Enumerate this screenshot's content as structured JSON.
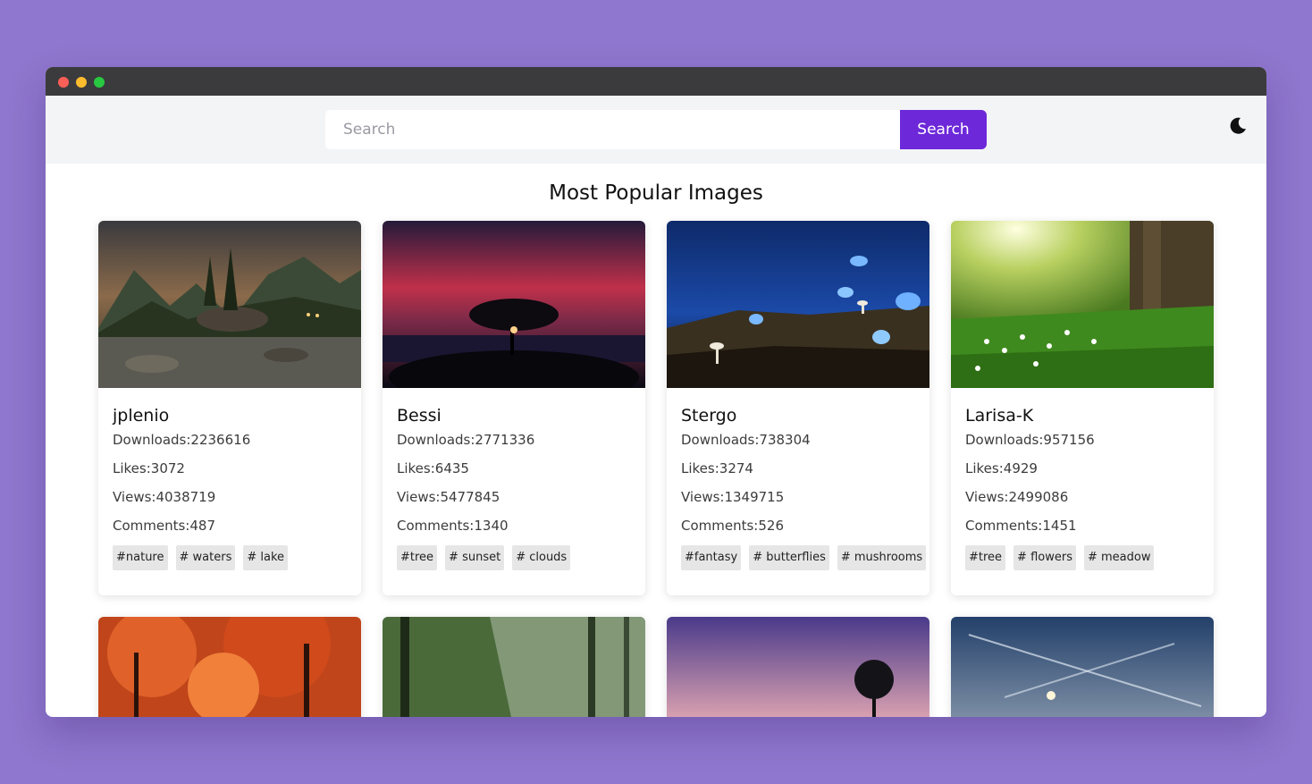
{
  "search": {
    "placeholder": "Search",
    "button_label": "Search"
  },
  "page": {
    "title": "Most Popular Images"
  },
  "cards": [
    {
      "user": "jplenio",
      "downloads": "Downloads:2236616",
      "likes": "Likes:3072",
      "views": "Views:4038719",
      "comments": "Comments:487",
      "tags": [
        "#nature",
        "# waters",
        "# lake"
      ]
    },
    {
      "user": "Bessi",
      "downloads": "Downloads:2771336",
      "likes": "Likes:6435",
      "views": "Views:5477845",
      "comments": "Comments:1340",
      "tags": [
        "#tree",
        "# sunset",
        "# clouds"
      ]
    },
    {
      "user": "Stergo",
      "downloads": "Downloads:738304",
      "likes": "Likes:3274",
      "views": "Views:1349715",
      "comments": "Comments:526",
      "tags": [
        "#fantasy",
        "# butterflies",
        "# mushrooms"
      ]
    },
    {
      "user": "Larisa-K",
      "downloads": "Downloads:957156",
      "likes": "Likes:4929",
      "views": "Views:2499086",
      "comments": "Comments:1451",
      "tags": [
        "#tree",
        "# flowers",
        "# meadow"
      ]
    }
  ],
  "colors": {
    "accent": "#6d28d9",
    "background": "#8f76ce",
    "titlebar": "#3b3b3d"
  },
  "icons": {
    "theme_toggle": "moon-icon"
  }
}
